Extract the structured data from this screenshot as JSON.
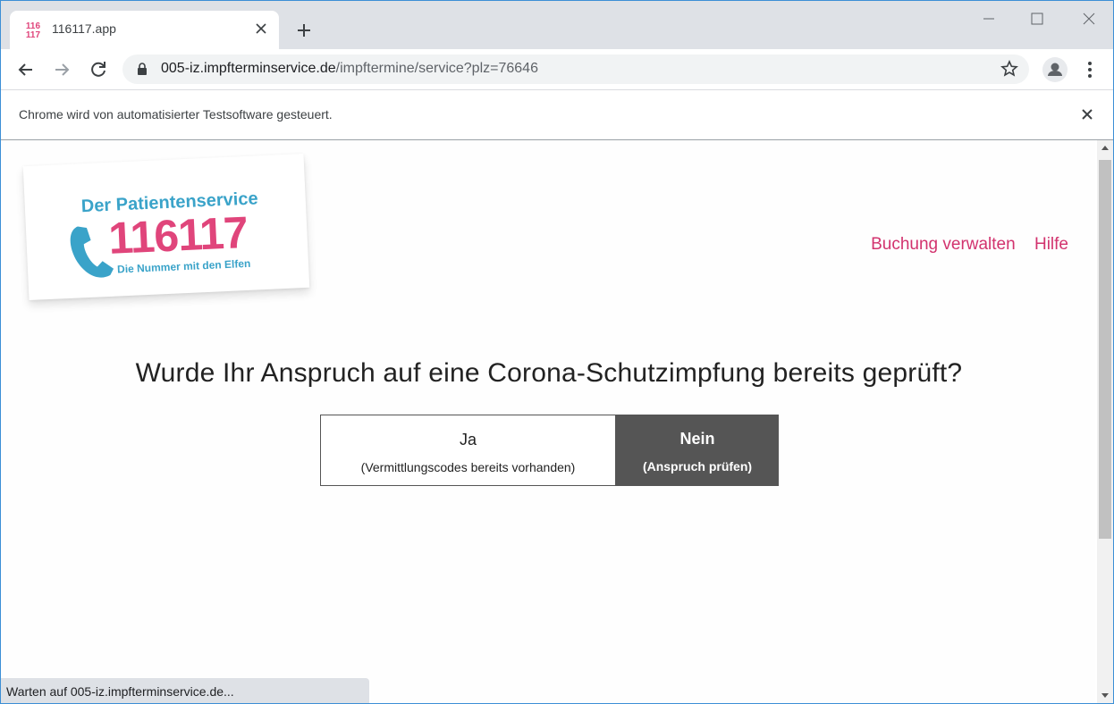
{
  "browser": {
    "tab_title": "116117.app",
    "favicon_text_top": "116",
    "favicon_text_bottom": "117",
    "url_host": "005-iz.impfterminservice.de",
    "url_path": "/impftermine/service?plz=76646",
    "infobar_text": "Chrome wird von automatisierter Testsoftware gesteuert.",
    "status_text": "Warten auf 005-iz.impfterminservice.de..."
  },
  "logo": {
    "title": "Der Patientenservice",
    "number": "116117",
    "tagline": "Die Nummer mit den Elfen"
  },
  "nav": {
    "manage_booking": "Buchung verwalten",
    "help": "Hilfe"
  },
  "main": {
    "question": "Wurde Ihr Anspruch auf eine Corona-Schutzimpfung bereits geprüft?",
    "yes_label": "Ja",
    "yes_sub": "(Vermittlungscodes bereits vorhanden)",
    "no_label": "Nein",
    "no_sub": "(Anspruch prüfen)"
  },
  "colors": {
    "accent_pink": "#d2336e",
    "logo_blue": "#3aa3c9",
    "selected_bg": "#555555"
  }
}
